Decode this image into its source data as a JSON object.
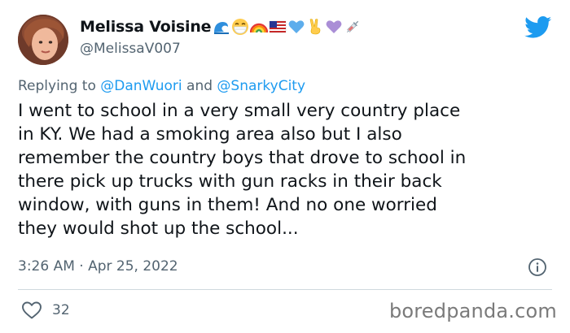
{
  "author": {
    "name": "Melissa Voisine",
    "handle": "@MelissaV007",
    "name_emojis": [
      "wave-emoji",
      "face-with-mask-emoji",
      "rainbow-emoji",
      "us-flag-emoji",
      "blue-heart-emoji",
      "victory-hand-emoji",
      "purple-heart-emoji",
      "syringe-emoji"
    ]
  },
  "reply_context": {
    "prefix": "Replying to",
    "mention_1": "@DanWuori",
    "connector": "and",
    "mention_2": "@SnarkyCity"
  },
  "tweet": {
    "lines": [
      "I went to school in a very small very country place",
      "in KY. We had a smoking area also but I also",
      "remember the country boys that drove to school in",
      "there pick up trucks with gun racks in their back",
      "window, with guns in them! And no one worried",
      "they would shot up the school..."
    ],
    "timestamp": "3:26 AM · Apr 25, 2022"
  },
  "engagement": {
    "like_count": "32"
  },
  "watermark": "boredpanda.com",
  "colors": {
    "twitter_blue": "#1d9bf0",
    "text_primary": "#0f1419",
    "text_secondary": "#536471",
    "divider": "#cfd9de"
  },
  "icons": {
    "brand": "twitter-bird-icon",
    "info": "info-icon",
    "like": "heart-outline-icon"
  }
}
